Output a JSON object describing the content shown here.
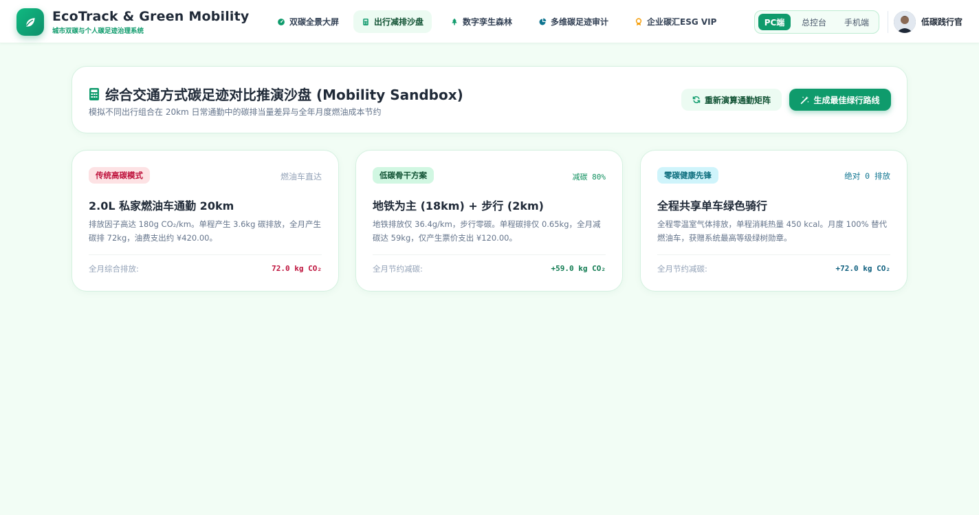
{
  "header": {
    "brand_title": "EcoTrack & Green Mobility",
    "brand_subtitle": "城市双碳与个人碳足迹治理系统",
    "logo_icon": "leaf-icon",
    "nav": [
      {
        "label": "双碳全景大屏",
        "icon": "gauge-icon",
        "active": false
      },
      {
        "label": "出行减排沙盘",
        "icon": "calculator-icon",
        "active": true
      },
      {
        "label": "数字孪生森林",
        "icon": "tree-icon",
        "active": false
      },
      {
        "label": "多维碳足迹审计",
        "icon": "pie-chart-icon",
        "active": false
      },
      {
        "label": "企业碳汇ESG VIP",
        "icon": "award-icon",
        "active": false
      }
    ],
    "view_switch": [
      {
        "label": "PC端",
        "active": true
      },
      {
        "label": "总控台",
        "active": false
      },
      {
        "label": "手机端",
        "active": false
      }
    ],
    "user_name": "低碳践行官"
  },
  "hero": {
    "title": "综合交通方式碳足迹对比推演沙盘 (Mobility Sandbox)",
    "subtitle": "模拟不同出行组合在 20km 日常通勤中的碳排当量差异与全年月度燃油成本节约",
    "recalc_label": "重新演算通勤矩阵",
    "generate_label": "生成最佳绿行路线"
  },
  "cards": [
    {
      "badge": "传统高碳模式",
      "tag": "燃油车直达",
      "title": "2.0L 私家燃油车通勤 20km",
      "desc": "排放因子高达 180g CO₂/km。单程产生 3.6kg 碳排放，全月产生碳排 72kg，油费支出约 ¥420.00。",
      "foot_label": "全月综合排放:",
      "foot_value": "72.0 kg CO₂"
    },
    {
      "badge": "低碳骨干方案",
      "tag": "减碳 80%",
      "title": "地铁为主 (18km) + 步行 (2km)",
      "desc": "地铁排放仅 36.4g/km，步行零碳。单程碳排仅 0.65kg，全月减碳达 59kg，仅产生票价支出 ¥120.00。",
      "foot_label": "全月节约减碳:",
      "foot_value": "+59.0 kg CO₂"
    },
    {
      "badge": "零碳健康先锋",
      "tag": "绝对 0 排放",
      "title": "全程共享单车绿色骑行",
      "desc": "全程零温室气体排放，单程消耗热量 450 kcal。月度 100% 替代燃油车，获赠系统最高等级绿树勋章。",
      "foot_label": "全月节约减碳:",
      "foot_value": "+72.0 kg CO₂"
    }
  ],
  "colors": {
    "brand": "#0f9b6c",
    "background": "#f2fdf5",
    "danger": "#be123c"
  }
}
